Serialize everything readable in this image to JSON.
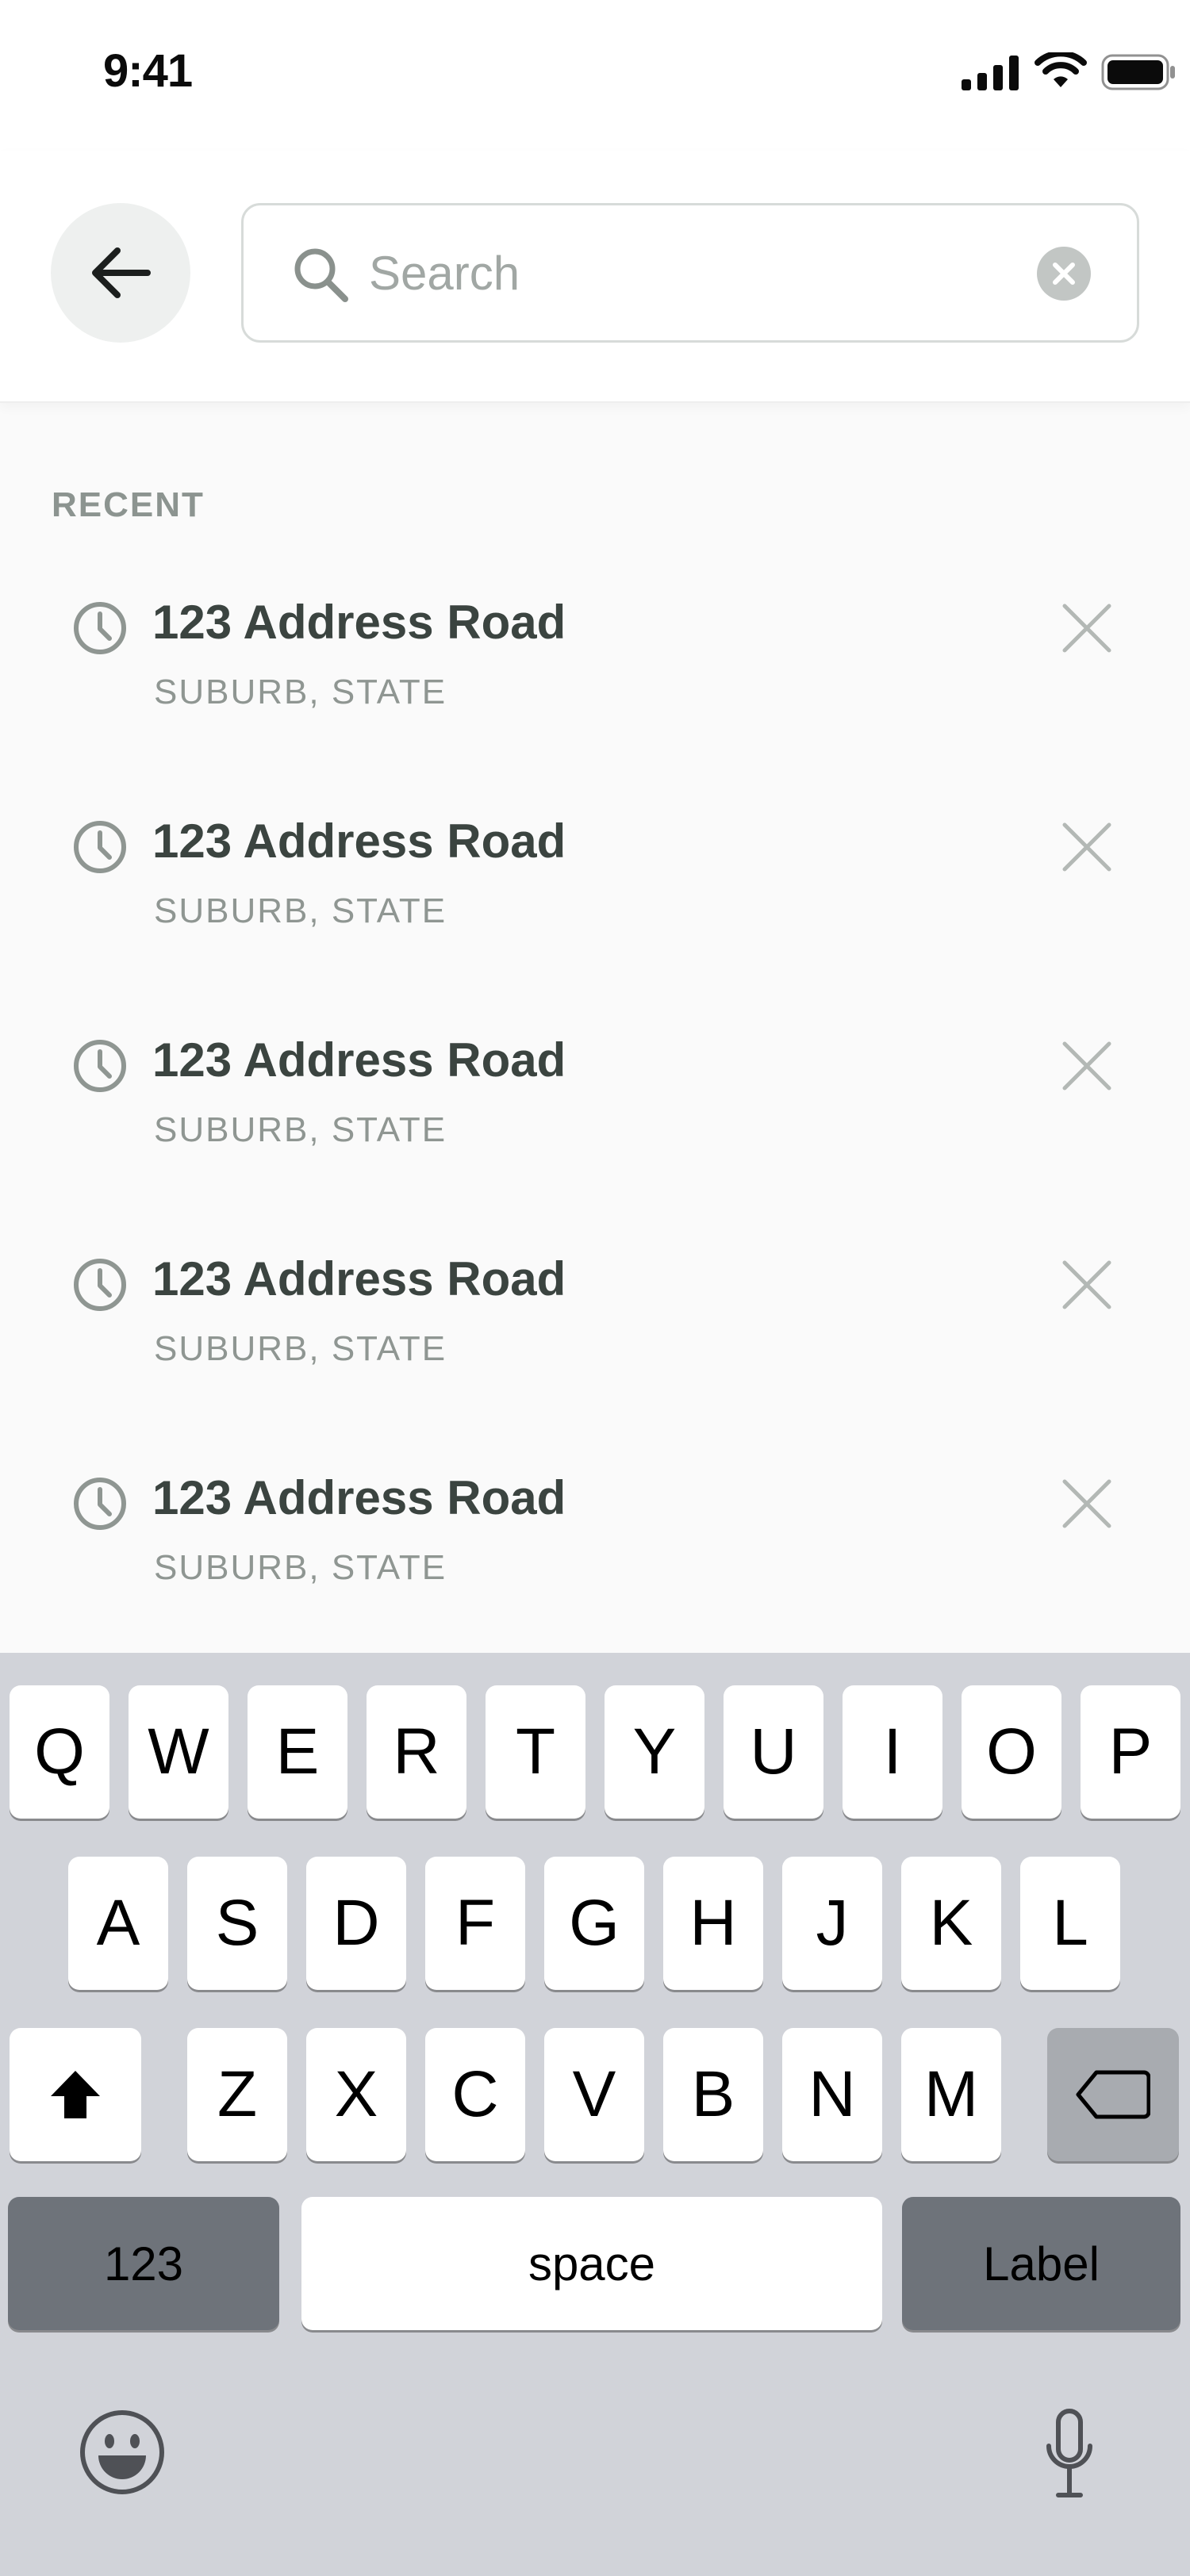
{
  "status_bar": {
    "time": "9:41"
  },
  "header": {
    "search": {
      "placeholder": "Search",
      "value": ""
    }
  },
  "recent": {
    "heading": "RECENT",
    "items": [
      {
        "title": "123 Address Road",
        "subtitle": "SUBURB, STATE"
      },
      {
        "title": "123 Address Road",
        "subtitle": "SUBURB, STATE"
      },
      {
        "title": "123 Address Road",
        "subtitle": "SUBURB, STATE"
      },
      {
        "title": "123 Address Road",
        "subtitle": "SUBURB, STATE"
      },
      {
        "title": "123 Address Road",
        "subtitle": "SUBURB, STATE"
      }
    ]
  },
  "keyboard": {
    "row1": [
      "Q",
      "W",
      "E",
      "R",
      "T",
      "Y",
      "U",
      "I",
      "O",
      "P"
    ],
    "row2": [
      "A",
      "S",
      "D",
      "F",
      "G",
      "H",
      "J",
      "K",
      "L"
    ],
    "row3": [
      "Z",
      "X",
      "C",
      "V",
      "B",
      "N",
      "M"
    ],
    "numbers_label": "123",
    "space_label": "space",
    "return_label": "Label",
    "icons": [
      "shift-icon",
      "backspace-icon",
      "emoji-icon",
      "microphone-icon"
    ]
  },
  "colors": {
    "header_background": "#ffffff",
    "list_background": "#fafafa",
    "title_text": "#3b4440",
    "muted_text": "#8f9692",
    "keyboard_background": "#d1d3d9"
  }
}
